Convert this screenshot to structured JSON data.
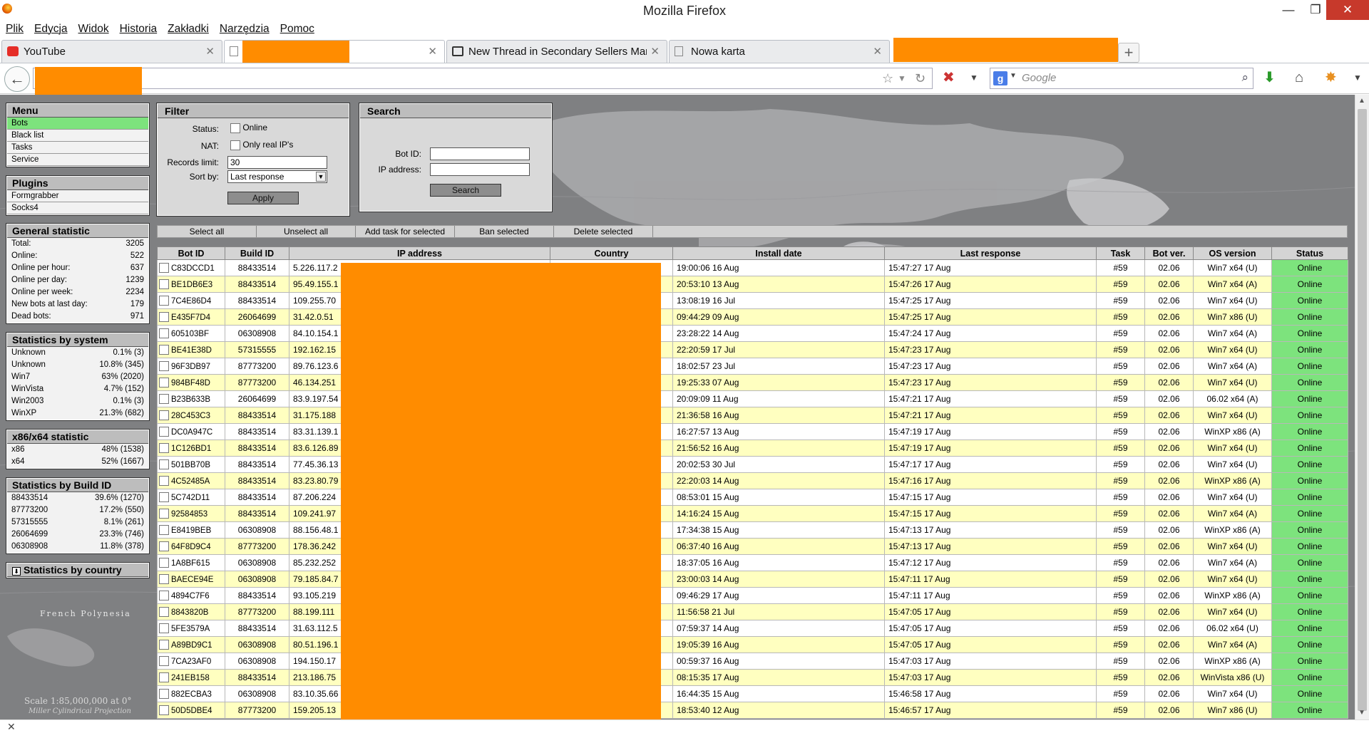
{
  "window": {
    "title": "Mozilla Firefox"
  },
  "menubar": [
    "Plik",
    "Edycja",
    "Widok",
    "Historia",
    "Zakładki",
    "Narzędzia",
    "Pomoc"
  ],
  "tabs": [
    {
      "label": "YouTube",
      "icon": "youtube-icon"
    },
    {
      "label": "",
      "icon": "blank-page-icon"
    },
    {
      "label": "New Thread in Secondary Sellers Mar...",
      "icon": "forum-icon"
    },
    {
      "label": "Nowa karta",
      "icon": "blank-page-icon"
    }
  ],
  "search": {
    "engine": "g",
    "placeholder": "Google"
  },
  "status_close": "✕",
  "colors": {
    "accent_online": "#7de37d",
    "redaction": "#ff8c00",
    "row_highlight": "#ffffc0"
  },
  "left": {
    "menu_title": "Menu",
    "menu_items": [
      "Bots",
      "Black list",
      "Tasks",
      "Service"
    ],
    "plugins_title": "Plugins",
    "plugins": [
      "Formgrabber",
      "Socks4"
    ],
    "general_title": "General statistic",
    "general": [
      {
        "label": "Total:",
        "value": "3205"
      },
      {
        "label": "Online:",
        "value": "522"
      },
      {
        "label": "Online per hour:",
        "value": "637"
      },
      {
        "label": "Online per day:",
        "value": "1239"
      },
      {
        "label": "Online per week:",
        "value": "2234"
      },
      {
        "label": "New bots at last day:",
        "value": "179"
      },
      {
        "label": "Dead bots:",
        "value": "971"
      }
    ],
    "system_title": "Statistics by system",
    "system": [
      {
        "label": "Unknown",
        "value": "0.1% (3)"
      },
      {
        "label": "Unknown",
        "value": "10.8% (345)"
      },
      {
        "label": "Win7",
        "value": "63% (2020)"
      },
      {
        "label": "WinVista",
        "value": "4.7% (152)"
      },
      {
        "label": "Win2003",
        "value": "0.1% (3)"
      },
      {
        "label": "WinXP",
        "value": "21.3% (682)"
      }
    ],
    "arch_title": "x86/x64 statistic",
    "arch": [
      {
        "label": "x86",
        "value": "48% (1538)"
      },
      {
        "label": "x64",
        "value": "52% (1667)"
      }
    ],
    "build_title": "Statistics by Build ID",
    "build": [
      {
        "label": "88433514",
        "value": "39.6% (1270)"
      },
      {
        "label": "87773200",
        "value": "17.2% (550)"
      },
      {
        "label": "57315555",
        "value": "8.1% (261)"
      },
      {
        "label": "26064699",
        "value": "23.3% (746)"
      },
      {
        "label": "06308908",
        "value": "11.8% (378)"
      }
    ],
    "country_title": "Statistics by country",
    "map_caption": "Scale 1:85,000,000 at 0°",
    "map_caption2": "Miller Cylindrical Projection",
    "map_label": "French Polynesia"
  },
  "filter": {
    "title": "Filter",
    "status_label": "Status:",
    "status_opt": "Online",
    "nat_label": "NAT:",
    "nat_opt": "Only real IP's",
    "records_label": "Records limit:",
    "records_value": "30",
    "sort_label": "Sort by:",
    "sort_value": "Last response",
    "apply": "Apply"
  },
  "searchpanel": {
    "title": "Search",
    "botid_label": "Bot ID:",
    "ip_label": "IP address:",
    "button": "Search"
  },
  "actions": [
    "Select all",
    "Unselect all",
    "Add task for selected",
    "Ban selected",
    "Delete selected"
  ],
  "table": {
    "headers": [
      "Bot ID",
      "Build ID",
      "IP address",
      "Country",
      "Install date",
      "Last response",
      "Task",
      "Bot ver.",
      "OS version",
      "Status"
    ],
    "rows": [
      [
        "C83DCCD1",
        "88433514",
        "5.226.117.2",
        "19:00:06 16 Aug",
        "15:47:27 17 Aug",
        "#59",
        "02.06",
        "Win7 x64 (U)",
        "Online"
      ],
      [
        "BE1DB6E3",
        "88433514",
        "95.49.155.1",
        "20:53:10 13 Aug",
        "15:47:26 17 Aug",
        "#59",
        "02.06",
        "Win7 x64 (A)",
        "Online"
      ],
      [
        "7C4E86D4",
        "88433514",
        "109.255.70",
        "13:08:19 16 Jul",
        "15:47:25 17 Aug",
        "#59",
        "02.06",
        "Win7 x64 (U)",
        "Online"
      ],
      [
        "E435F7D4",
        "26064699",
        "31.42.0.51",
        "09:44:29 09 Aug",
        "15:47:25 17 Aug",
        "#59",
        "02.06",
        "Win7 x86 (U)",
        "Online"
      ],
      [
        "605103BF",
        "06308908",
        "84.10.154.1",
        "23:28:22 14 Aug",
        "15:47:24 17 Aug",
        "#59",
        "02.06",
        "Win7 x64 (A)",
        "Online"
      ],
      [
        "BE41E38D",
        "57315555",
        "192.162.15",
        "22:20:59 17 Jul",
        "15:47:23 17 Aug",
        "#59",
        "02.06",
        "Win7 x64 (U)",
        "Online"
      ],
      [
        "96F3DB97",
        "87773200",
        "89.76.123.6",
        "18:02:57 23 Jul",
        "15:47:23 17 Aug",
        "#59",
        "02.06",
        "Win7 x64 (A)",
        "Online"
      ],
      [
        "984BF48D",
        "87773200",
        "46.134.251",
        "19:25:33 07 Aug",
        "15:47:23 17 Aug",
        "#59",
        "02.06",
        "Win7 x64 (U)",
        "Online"
      ],
      [
        "B23B633B",
        "26064699",
        "83.9.197.54",
        "20:09:09 11 Aug",
        "15:47:21 17 Aug",
        "#59",
        "02.06",
        "06.02 x64 (A)",
        "Online"
      ],
      [
        "28C453C3",
        "88433514",
        "31.175.188",
        "21:36:58 16 Aug",
        "15:47:21 17 Aug",
        "#59",
        "02.06",
        "Win7 x64 (U)",
        "Online"
      ],
      [
        "DC0A947C",
        "88433514",
        "83.31.139.1",
        "16:27:57 13 Aug",
        "15:47:19 17 Aug",
        "#59",
        "02.06",
        "WinXP x86 (A)",
        "Online"
      ],
      [
        "1C126BD1",
        "88433514",
        "83.6.126.89",
        "21:56:52 16 Aug",
        "15:47:19 17 Aug",
        "#59",
        "02.06",
        "Win7 x64 (U)",
        "Online"
      ],
      [
        "501BB70B",
        "88433514",
        "77.45.36.13",
        "20:02:53 30 Jul",
        "15:47:17 17 Aug",
        "#59",
        "02.06",
        "Win7 x64 (U)",
        "Online"
      ],
      [
        "4C52485A",
        "88433514",
        "83.23.80.79",
        "22:20:03 14 Aug",
        "15:47:16 17 Aug",
        "#59",
        "02.06",
        "WinXP x86 (A)",
        "Online"
      ],
      [
        "5C742D11",
        "88433514",
        "87.206.224",
        "08:53:01 15 Aug",
        "15:47:15 17 Aug",
        "#59",
        "02.06",
        "Win7 x64 (U)",
        "Online"
      ],
      [
        "92584853",
        "88433514",
        "109.241.97",
        "14:16:24 15 Aug",
        "15:47:15 17 Aug",
        "#59",
        "02.06",
        "Win7 x64 (A)",
        "Online"
      ],
      [
        "E8419BEB",
        "06308908",
        "88.156.48.1",
        "17:34:38 15 Aug",
        "15:47:13 17 Aug",
        "#59",
        "02.06",
        "WinXP x86 (A)",
        "Online"
      ],
      [
        "64F8D9C4",
        "87773200",
        "178.36.242",
        "06:37:40 16 Aug",
        "15:47:13 17 Aug",
        "#59",
        "02.06",
        "Win7 x64 (U)",
        "Online"
      ],
      [
        "1A8BF615",
        "06308908",
        "85.232.252",
        "18:37:05 16 Aug",
        "15:47:12 17 Aug",
        "#59",
        "02.06",
        "Win7 x64 (A)",
        "Online"
      ],
      [
        "BAECE94E",
        "06308908",
        "79.185.84.7",
        "23:00:03 14 Aug",
        "15:47:11 17 Aug",
        "#59",
        "02.06",
        "Win7 x64 (U)",
        "Online"
      ],
      [
        "4894C7F6",
        "88433514",
        "93.105.219",
        "09:46:29 17 Aug",
        "15:47:11 17 Aug",
        "#59",
        "02.06",
        "WinXP x86 (A)",
        "Online"
      ],
      [
        "8843820B",
        "87773200",
        "88.199.111",
        "11:56:58 21 Jul",
        "15:47:05 17 Aug",
        "#59",
        "02.06",
        "Win7 x64 (U)",
        "Online"
      ],
      [
        "5FE3579A",
        "88433514",
        "31.63.112.5",
        "07:59:37 14 Aug",
        "15:47:05 17 Aug",
        "#59",
        "02.06",
        "06.02 x64 (U)",
        "Online"
      ],
      [
        "A89BD9C1",
        "06308908",
        "80.51.196.1",
        "19:05:39 16 Aug",
        "15:47:05 17 Aug",
        "#59",
        "02.06",
        "Win7 x64 (A)",
        "Online"
      ],
      [
        "7CA23AF0",
        "06308908",
        "194.150.17",
        "00:59:37 16 Aug",
        "15:47:03 17 Aug",
        "#59",
        "02.06",
        "WinXP x86 (A)",
        "Online"
      ],
      [
        "241EB158",
        "88433514",
        "213.186.75",
        "08:15:35 17 Aug",
        "15:47:03 17 Aug",
        "#59",
        "02.06",
        "WinVista x86 (U)",
        "Online"
      ],
      [
        "882ECBA3",
        "06308908",
        "83.10.35.66",
        "16:44:35 15 Aug",
        "15:46:58 17 Aug",
        "#59",
        "02.06",
        "Win7 x64 (U)",
        "Online"
      ],
      [
        "50D5DBE4",
        "87773200",
        "159.205.13",
        "18:53:40 12 Aug",
        "15:46:57 17 Aug",
        "#59",
        "02.06",
        "Win7 x86 (U)",
        "Online"
      ]
    ]
  }
}
